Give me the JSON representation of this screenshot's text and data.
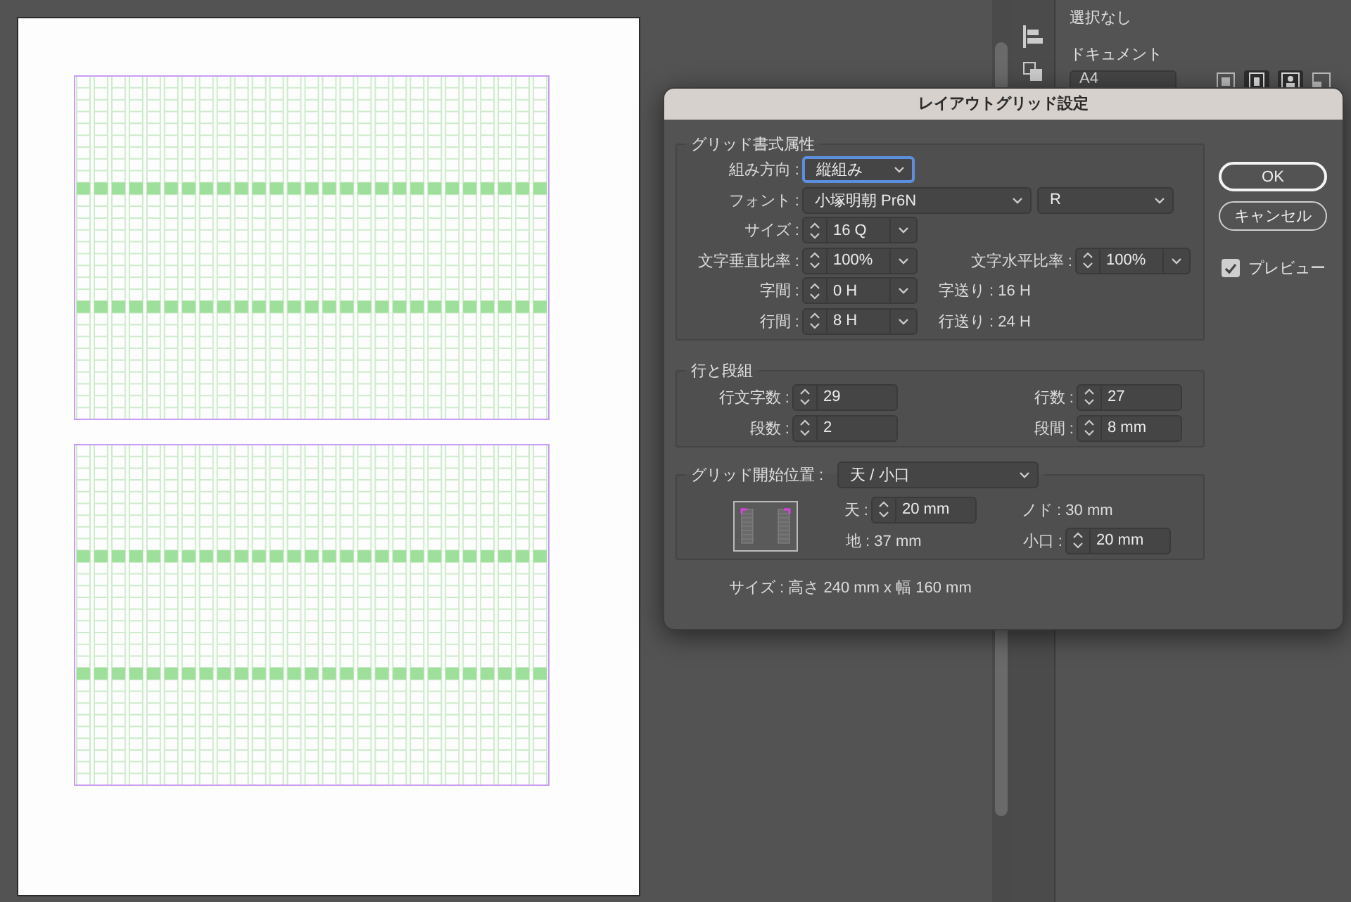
{
  "panel": {
    "selection": "選択なし",
    "section": "ドキュメント",
    "page_size": "A4"
  },
  "dialog": {
    "title": "レイアウトグリッド設定",
    "groups": [
      {
        "kind": "format",
        "title": "グリッド書式属性",
        "rows": [
          [
            {
              "kind": "dropdown",
              "label": "組み方向 :",
              "value": "縦組み",
              "focused": true
            }
          ],
          [
            {
              "kind": "dropdown",
              "label": "フォント :",
              "value": "小塚明朝 Pr6N",
              "focused": false
            },
            {
              "kind": "dropdown",
              "value": "R",
              "focused": false
            }
          ],
          [
            {
              "kind": "combo",
              "label": "サイズ :",
              "value": "16 Q"
            }
          ],
          [
            {
              "kind": "combo",
              "label": "文字垂直比率 :",
              "value": "100%"
            },
            {
              "kind": "combo",
              "label": "文字水平比率 :",
              "value": "100%"
            }
          ],
          [
            {
              "kind": "combo",
              "label": "字間 :",
              "value": "0 H"
            },
            {
              "kind": "readout",
              "text": "字送り : 16 H"
            }
          ],
          [
            {
              "kind": "combo",
              "label": "行間 :",
              "value": "8 H"
            },
            {
              "kind": "readout",
              "text": "行送り : 24 H"
            }
          ]
        ]
      },
      {
        "kind": "columns",
        "title": "行と段組",
        "rows": [
          [
            {
              "kind": "stepper",
              "label": "行文字数 :",
              "value": "29"
            },
            {
              "kind": "stepper",
              "label": "行数 :",
              "value": "27"
            }
          ],
          [
            {
              "kind": "stepper",
              "label": "段数 :",
              "value": "2"
            },
            {
              "kind": "stepper",
              "label": "段間 :",
              "value": "8 mm"
            }
          ]
        ]
      },
      {
        "kind": "start",
        "title": "グリッド開始位置 :",
        "control": {
          "kind": "dropdown",
          "value": "天 / 小口",
          "focused": false
        },
        "rows": [
          [
            {
              "kind": "stepper",
              "label": "天 :",
              "value": "20 mm"
            },
            {
              "kind": "readout",
              "text": "ノド : 30 mm"
            }
          ],
          [
            {
              "kind": "readout",
              "text": "地 : 37 mm"
            },
            {
              "kind": "stepper",
              "label": "小口 :",
              "value": "20 mm"
            }
          ]
        ]
      }
    ],
    "size_note": "サイズ : 高さ 240 mm x 幅 160 mm",
    "buttons": [
      {
        "label": "OK",
        "default": true
      },
      {
        "label": "キャンセル",
        "default": false
      }
    ],
    "preview": {
      "label": "プレビュー",
      "checked": true
    }
  }
}
